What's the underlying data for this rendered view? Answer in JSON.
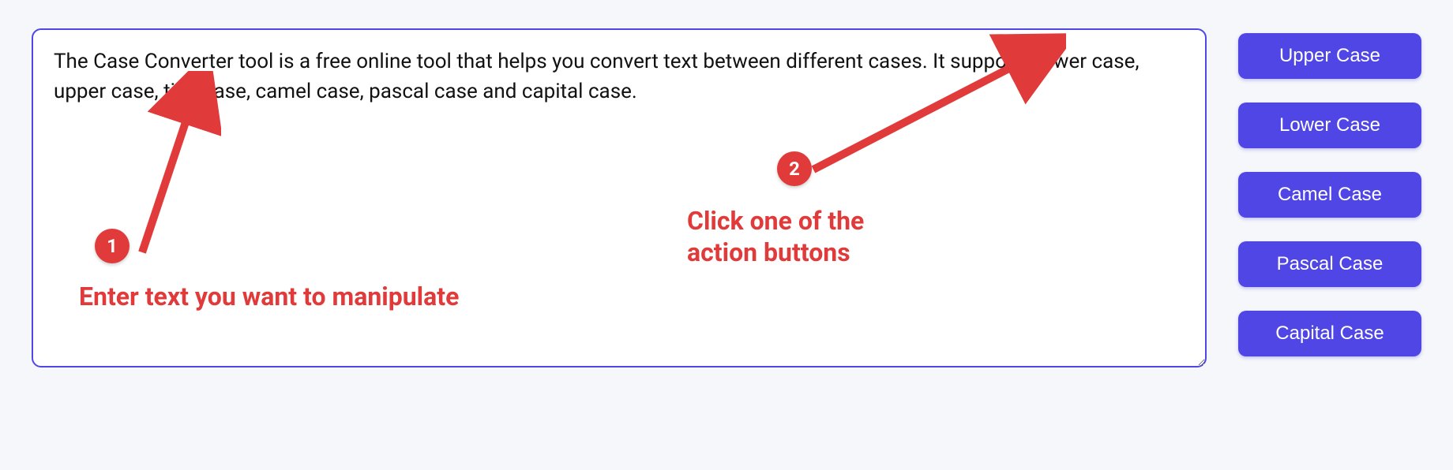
{
  "input": {
    "value": "The Case Converter tool is a free online tool that helps you convert text between different cases. It supports lower case, upper case, title case, camel case, pascal case and capital case. "
  },
  "buttons": {
    "upper": "Upper Case",
    "lower": "Lower Case",
    "camel": "Camel Case",
    "pascal": "Pascal Case",
    "capital": "Capital Case"
  },
  "annotations": {
    "step1_badge": "1",
    "step1_text": "Enter text you want to manipulate",
    "step2_badge": "2",
    "step2_text": "Click one of the\naction buttons"
  },
  "colors": {
    "accent": "#4f46e5",
    "annotation": "#e03a3a"
  }
}
